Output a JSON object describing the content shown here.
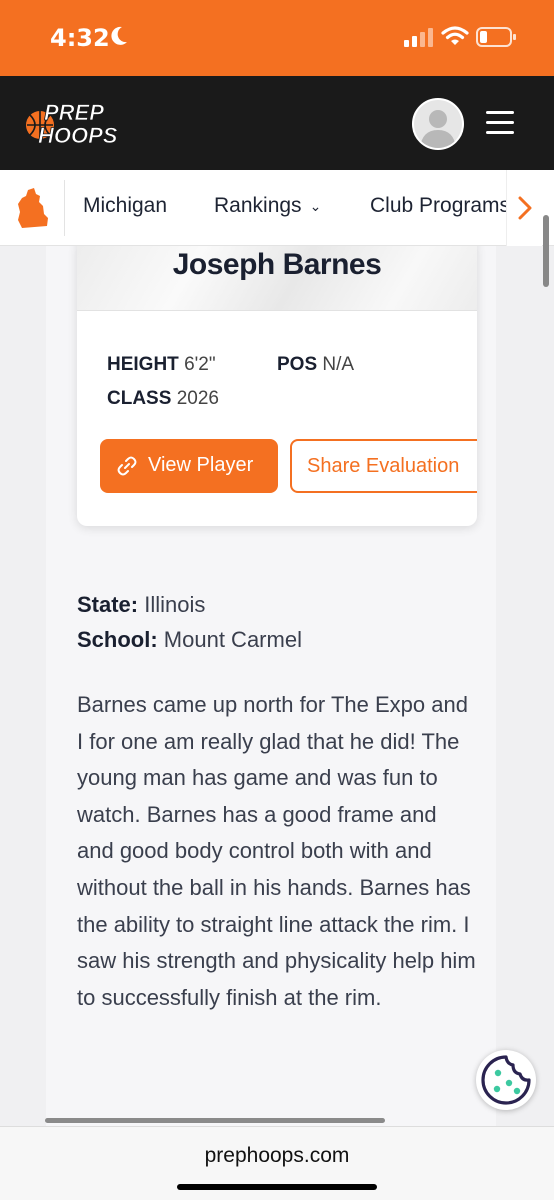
{
  "status_bar": {
    "time": "4:32",
    "icons": [
      "moon-icon",
      "signal-icon",
      "wifi-icon",
      "battery-icon"
    ]
  },
  "header": {
    "logo_line1": "PREP",
    "logo_line2": "HOOPS",
    "icons": [
      "avatar",
      "hamburger-menu-icon"
    ]
  },
  "nav": {
    "state_icon": "michigan-state-icon",
    "items": [
      {
        "label": "Michigan"
      },
      {
        "label": "Rankings"
      },
      {
        "label": "Club Programs"
      }
    ],
    "more_icon": "chevron-right-icon"
  },
  "player_card": {
    "name": "Joseph Barnes",
    "height_label": "HEIGHT",
    "height_value": "6'2\"",
    "pos_label": "POS",
    "pos_value": "N/A",
    "class_label": "CLASS",
    "class_value": "2026",
    "view_button": "View Player",
    "share_button": "Share Evaluation"
  },
  "details": {
    "state_label": "State:",
    "state_value": "Illinois",
    "school_label": "School:",
    "school_value": "Mount Carmel"
  },
  "article": {
    "text": "Barnes came up north for The Expo and I for one am really glad that he did! The young man has game and was fun to watch. Barnes has a good frame and and good body control both with and without the ball in his hands. Barnes has the ability to straight line attack the rim. I saw his strength and physicality help him to successfully finish at the rim."
  },
  "browser": {
    "url": "prephoops.com"
  },
  "colors": {
    "brand_orange": "#f47021",
    "header_dark": "#1a1a1a",
    "text_dark": "#1a2030",
    "cookie_accent": "#2a2350",
    "cookie_dots": "#3cc9a0"
  }
}
